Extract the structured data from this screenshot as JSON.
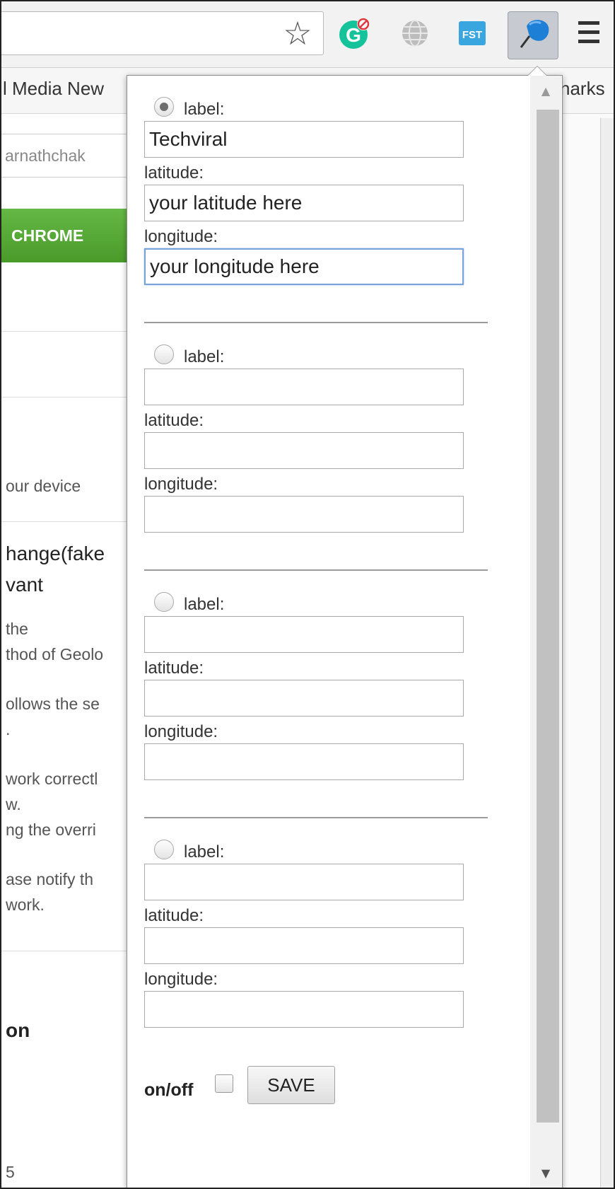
{
  "toolbar": {
    "icons": [
      "bookmark-star-icon",
      "grammarly-icon",
      "globe-icon",
      "fst-icon",
      "location-pin-icon",
      "hamburger-menu-icon"
    ],
    "fst_text": "FST",
    "grammarly_text": "G",
    "colors": {
      "grammarly": "#15c39a",
      "fst": "#3aa6df",
      "pin": "#1e7fd6"
    }
  },
  "bookmarks": {
    "left_text": "l Media New",
    "right_text": "narks"
  },
  "background": {
    "input_text": "arnathchak",
    "green_button": "CHROME",
    "text_device": "our device",
    "heading_1": "hange(fake",
    "heading_2": "vant",
    "lines": [
      "the",
      "thod of Geolo",
      "ollows the se",
      ".",
      "work correctl",
      "w.",
      "ng the overri",
      "ase notify th",
      "work."
    ],
    "heading_3": "on",
    "bottom_text": "5"
  },
  "popup": {
    "locations": [
      {
        "checked": true,
        "label_caption": "label:",
        "label_value": "Techviral",
        "latitude_caption": "latitude:",
        "latitude_value": "your latitude here",
        "longitude_caption": "longitude:",
        "longitude_value": "your longitude here"
      },
      {
        "checked": false,
        "label_caption": "label:",
        "label_value": "",
        "latitude_caption": "latitude:",
        "latitude_value": "",
        "longitude_caption": "longitude:",
        "longitude_value": ""
      },
      {
        "checked": false,
        "label_caption": "label:",
        "label_value": "",
        "latitude_caption": "latitude:",
        "latitude_value": "",
        "longitude_caption": "longitude:",
        "longitude_value": ""
      },
      {
        "checked": false,
        "label_caption": "label:",
        "label_value": "",
        "latitude_caption": "latitude:",
        "latitude_value": "",
        "longitude_caption": "longitude:",
        "longitude_value": ""
      }
    ],
    "onoff_label": "on/off",
    "save_label": "SAVE",
    "scroll_up": "▲",
    "scroll_down": "▼"
  }
}
